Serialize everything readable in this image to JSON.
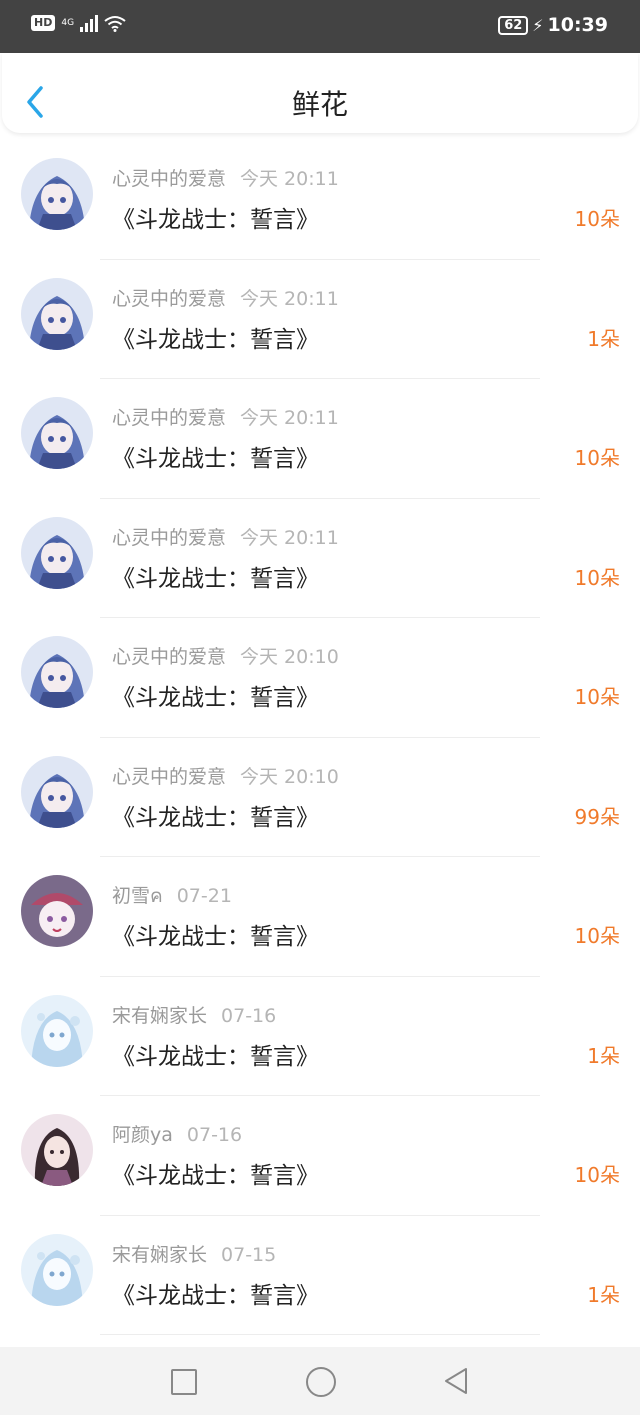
{
  "status_bar": {
    "hd_label": "HD",
    "network_label": "4G",
    "battery": "62",
    "time": "10:39"
  },
  "header": {
    "title": "鲜花",
    "back_icon": "chevron-left-icon",
    "accent_color": "#2aa6e8"
  },
  "records": [
    {
      "user": "心灵中的爱意",
      "time": "今天 20:11",
      "book": "《斗龙战士：誓言》",
      "count": "10朵",
      "avatar": "anime-blue-hair"
    },
    {
      "user": "心灵中的爱意",
      "time": "今天 20:11",
      "book": "《斗龙战士：誓言》",
      "count": "1朵",
      "avatar": "anime-blue-hair"
    },
    {
      "user": "心灵中的爱意",
      "time": "今天 20:11",
      "book": "《斗龙战士：誓言》",
      "count": "10朵",
      "avatar": "anime-blue-hair"
    },
    {
      "user": "心灵中的爱意",
      "time": "今天 20:11",
      "book": "《斗龙战士：誓言》",
      "count": "10朵",
      "avatar": "anime-blue-hair"
    },
    {
      "user": "心灵中的爱意",
      "time": "今天 20:10",
      "book": "《斗龙战士：誓言》",
      "count": "10朵",
      "avatar": "anime-blue-hair"
    },
    {
      "user": "心灵中的爱意",
      "time": "今天 20:10",
      "book": "《斗龙战士：誓言》",
      "count": "99朵",
      "avatar": "anime-blue-hair"
    },
    {
      "user": "初雪ค",
      "time": "07-21",
      "book": "《斗龙战士：誓言》",
      "count": "10朵",
      "avatar": "anime-pink-cap"
    },
    {
      "user": "宋有娴家长",
      "time": "07-16",
      "book": "《斗龙战士：誓言》",
      "count": "1朵",
      "avatar": "anime-light-blue"
    },
    {
      "user": "阿颜ya",
      "time": "07-16",
      "book": "《斗龙战士：誓言》",
      "count": "10朵",
      "avatar": "anime-dark-hair"
    },
    {
      "user": "宋有娴家长",
      "time": "07-15",
      "book": "《斗龙战士：誓言》",
      "count": "1朵",
      "avatar": "anime-light-blue"
    }
  ],
  "count_color": "#f07a2b",
  "nav_bar": {
    "recents_icon": "square-icon",
    "home_icon": "circle-icon",
    "back_icon": "triangle-back-icon"
  }
}
